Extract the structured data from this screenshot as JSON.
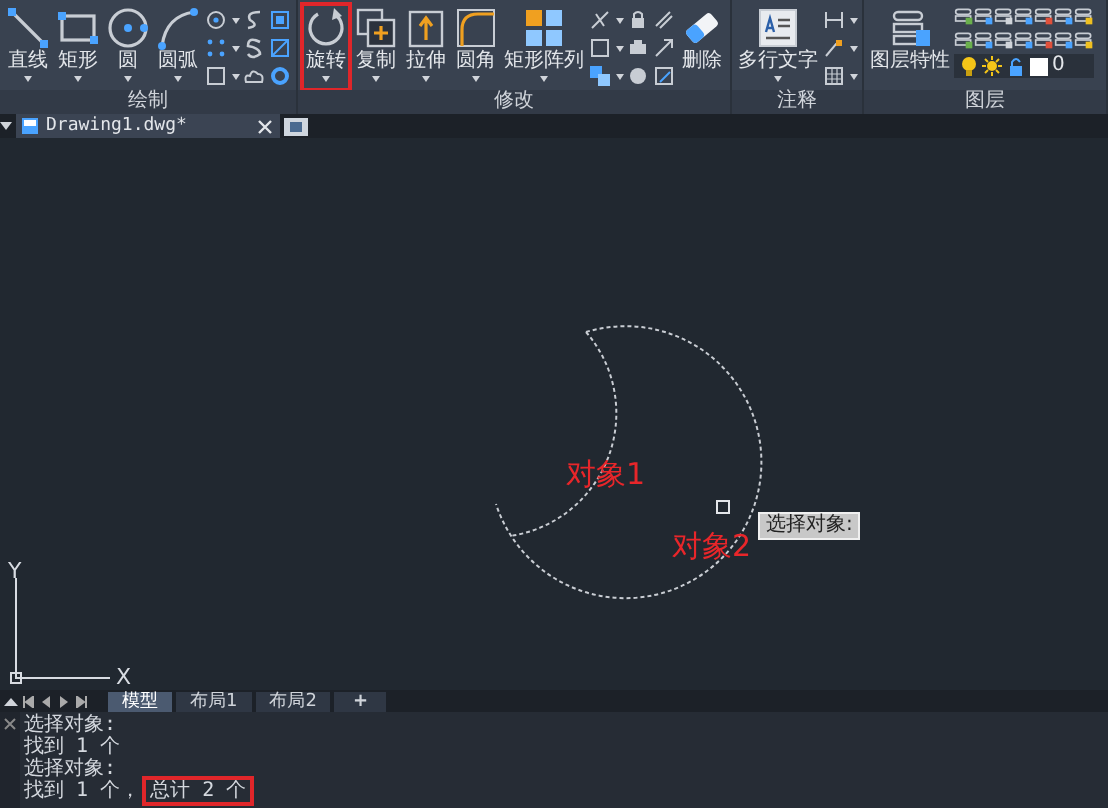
{
  "ribbon": {
    "panels": [
      {
        "kind": "draw",
        "label": "绘制",
        "tools": [
          {
            "kind": "line",
            "label": "直线",
            "dropdown": true,
            "highlighted": false
          },
          {
            "kind": "rect",
            "label": "矩形",
            "dropdown": true,
            "highlighted": false
          },
          {
            "kind": "circle",
            "label": "圆",
            "dropdown": true,
            "highlighted": false
          },
          {
            "kind": "arc",
            "label": "圆弧",
            "dropdown": true,
            "highlighted": false
          }
        ]
      },
      {
        "kind": "modify",
        "label": "修改",
        "tools": [
          {
            "kind": "rotate",
            "label": "旋转",
            "dropdown": true,
            "highlighted": true
          },
          {
            "kind": "copy",
            "label": "复制",
            "dropdown": true,
            "highlighted": false
          },
          {
            "kind": "stretch",
            "label": "拉伸",
            "dropdown": true,
            "highlighted": false
          },
          {
            "kind": "fillet",
            "label": "圆角",
            "dropdown": true,
            "highlighted": false
          },
          {
            "kind": "array",
            "label": "矩形阵列",
            "dropdown": true,
            "highlighted": false
          },
          {
            "kind": "erase",
            "label": "删除",
            "dropdown": false,
            "highlighted": false
          }
        ]
      },
      {
        "kind": "annotate",
        "label": "注释",
        "tools": [
          {
            "kind": "mtext",
            "label": "多行文字",
            "dropdown": true,
            "highlighted": false
          }
        ]
      },
      {
        "kind": "layers",
        "label": "图层",
        "tools": [
          {
            "kind": "layerprops",
            "label": "图层特性",
            "dropdown": false,
            "highlighted": false
          }
        ],
        "current_layer": "0"
      }
    ]
  },
  "document_tabs": [
    {
      "label": "Drawing1.dwg*",
      "selected": true
    }
  ],
  "canvas": {
    "labels": [
      {
        "text": "对象1"
      },
      {
        "text": "对象2"
      }
    ],
    "tooltip": "选择对象:",
    "axis_x": "X",
    "axis_y": "Y"
  },
  "layout_tabs": [
    {
      "label": "模型",
      "kind": "tab",
      "selected": true
    },
    {
      "label": "布局1",
      "kind": "tab",
      "selected": false
    },
    {
      "label": "布局2",
      "kind": "tab",
      "selected": false
    },
    {
      "label": "+",
      "kind": "add",
      "selected": false
    }
  ],
  "command_history": [
    {
      "segments": [
        {
          "text": "选择对象:",
          "highlighted": false
        }
      ]
    },
    {
      "segments": [
        {
          "text": "找到 1 个",
          "highlighted": false
        }
      ]
    },
    {
      "segments": [
        {
          "text": "选择对象:",
          "highlighted": false
        }
      ]
    },
    {
      "segments": [
        {
          "text": "找到 1 个，",
          "highlighted": false
        },
        {
          "text": "总计 2 个",
          "highlighted": true
        }
      ]
    }
  ]
}
